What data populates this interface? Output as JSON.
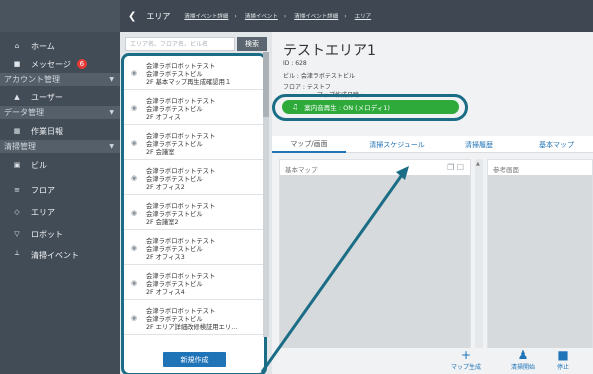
{
  "sidebar": {
    "items": [
      {
        "label": "ホーム",
        "icon": "home-icon",
        "glyph": "⌂"
      },
      {
        "label": "メッセージ",
        "icon": "message-icon",
        "glyph": "■",
        "badge": "6"
      },
      {
        "label": "ユーザー",
        "icon": "user-icon",
        "glyph": "▲"
      },
      {
        "label": "作業日報",
        "icon": "report-icon",
        "glyph": "▦"
      },
      {
        "label": "ビル",
        "icon": "building-icon",
        "glyph": "▣"
      },
      {
        "label": "フロア",
        "icon": "floor-icon",
        "glyph": "≡"
      },
      {
        "label": "エリア",
        "icon": "area-icon",
        "glyph": "◇"
      },
      {
        "label": "ロボット",
        "icon": "robot-icon",
        "glyph": "▽"
      },
      {
        "label": "清掃イベント",
        "icon": "cleaning-event-icon",
        "glyph": "┴"
      }
    ],
    "sections": [
      {
        "label": "アカウント管理"
      },
      {
        "label": "データ管理"
      },
      {
        "label": "清掃管理"
      }
    ]
  },
  "topbar": {
    "back_glyph": "❮",
    "title": "エリア",
    "breadcrumbs": [
      "清掃イベント詳細",
      "清掃イベント",
      "清掃イベント詳細",
      "エリア"
    ]
  },
  "search": {
    "placeholder": "エリア名、フロア名、ビル名",
    "button": "検索"
  },
  "area_list": [
    {
      "l1": "会津ラボロボットテスト",
      "l2": "会津ラボテストビル",
      "l3": "2F 基本マップ再生成確認用１"
    },
    {
      "l1": "会津ラボロボットテスト",
      "l2": "会津ラボテストビル",
      "l3": "2F オフィス"
    },
    {
      "l1": "会津ラボロボットテスト",
      "l2": "会津ラボテストビル",
      "l3": "2F 会議室"
    },
    {
      "l1": "会津ラボロボットテスト",
      "l2": "会津ラボテストビル",
      "l3": "2F オフィス2"
    },
    {
      "l1": "会津ラボロボットテスト",
      "l2": "会津ラボテストビル",
      "l3": "2F 会議室2"
    },
    {
      "l1": "会津ラボロボットテスト",
      "l2": "会津ラボテストビル",
      "l3": "2F オフィス3"
    },
    {
      "l1": "会津ラボロボットテスト",
      "l2": "会津ラボテストビル",
      "l3": "2F オフィス4"
    },
    {
      "l1": "会津ラボロボットテスト",
      "l2": "会津ラボテストビル",
      "l3": "2F エリア詳細改修検証用エリ..."
    }
  ],
  "new_button": "新規作成",
  "detail": {
    "title": "テストエリア1",
    "id": "ID : 628",
    "building": "ビル : 会津ラボテストビル",
    "floor": "フロア : テストフ",
    "map_date": "マップ作成日時 : -",
    "sound_note": "♫",
    "sound_status": "案内音再生 : ON (メロディ1)"
  },
  "tabs": [
    "マップ/画面",
    "清掃スケジュール",
    "清掃履歴",
    "基本マップ"
  ],
  "panels": {
    "left_title": "基本マップ",
    "right_title": "参考画面",
    "tools": "❐ ☐"
  },
  "bottom_actions": [
    {
      "label": "マップ生成",
      "icon": "plus-icon",
      "glyph": "+"
    },
    {
      "label": "清掃開始",
      "icon": "cleaning-start-icon",
      "glyph": "♟"
    },
    {
      "label": "停止",
      "icon": "stop-icon",
      "glyph": "■"
    }
  ],
  "colors": {
    "accent": "#1f73b7",
    "highlight": "#1a6d84",
    "sound_on": "#2eaa3b",
    "badge": "#e53935"
  }
}
